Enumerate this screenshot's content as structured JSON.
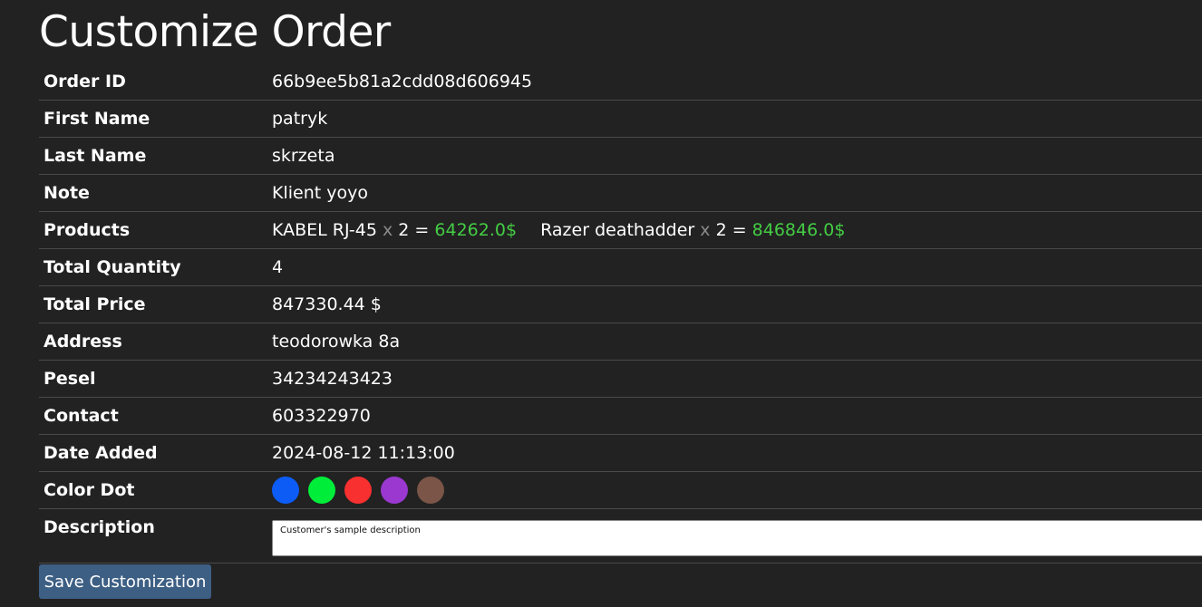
{
  "page": {
    "title": "Customize Order",
    "save_label": "Save Customization"
  },
  "order": {
    "fields": {
      "order_id": {
        "label": "Order ID",
        "value": "66b9ee5b81a2cdd08d606945"
      },
      "first_name": {
        "label": "First Name",
        "value": "patryk"
      },
      "last_name": {
        "label": "Last Name",
        "value": "skrzeta"
      },
      "note": {
        "label": "Note",
        "value": "Klient yoyo"
      },
      "products_label": "Products",
      "total_quantity": {
        "label": "Total Quantity",
        "value": "4"
      },
      "total_price": {
        "label": "Total Price",
        "value": "847330.44 $"
      },
      "address": {
        "label": "Address",
        "value": "teodorowka 8a"
      },
      "pesel": {
        "label": "Pesel",
        "value": "34234243423"
      },
      "contact": {
        "label": "Contact",
        "value": "603322970"
      },
      "date_added": {
        "label": "Date Added",
        "value": "2024-08-12 11:13:00"
      },
      "color_dot_label": "Color Dot",
      "description": {
        "label": "Description",
        "value": "Customer's sample description"
      }
    },
    "products": [
      {
        "name": "KABEL RJ-45",
        "times": "x",
        "qty": "2 =",
        "price": "64262.0$"
      },
      {
        "name": "Razer deathadder",
        "times": "x",
        "qty": "2 =",
        "price": "846846.0$"
      }
    ],
    "color_dots": [
      {
        "name": "blue",
        "color": "#0d5cf6"
      },
      {
        "name": "green",
        "color": "#00ee3a"
      },
      {
        "name": "red",
        "color": "#f83030"
      },
      {
        "name": "purple",
        "color": "#9a38d0"
      },
      {
        "name": "brown",
        "color": "#7a5548"
      }
    ]
  }
}
